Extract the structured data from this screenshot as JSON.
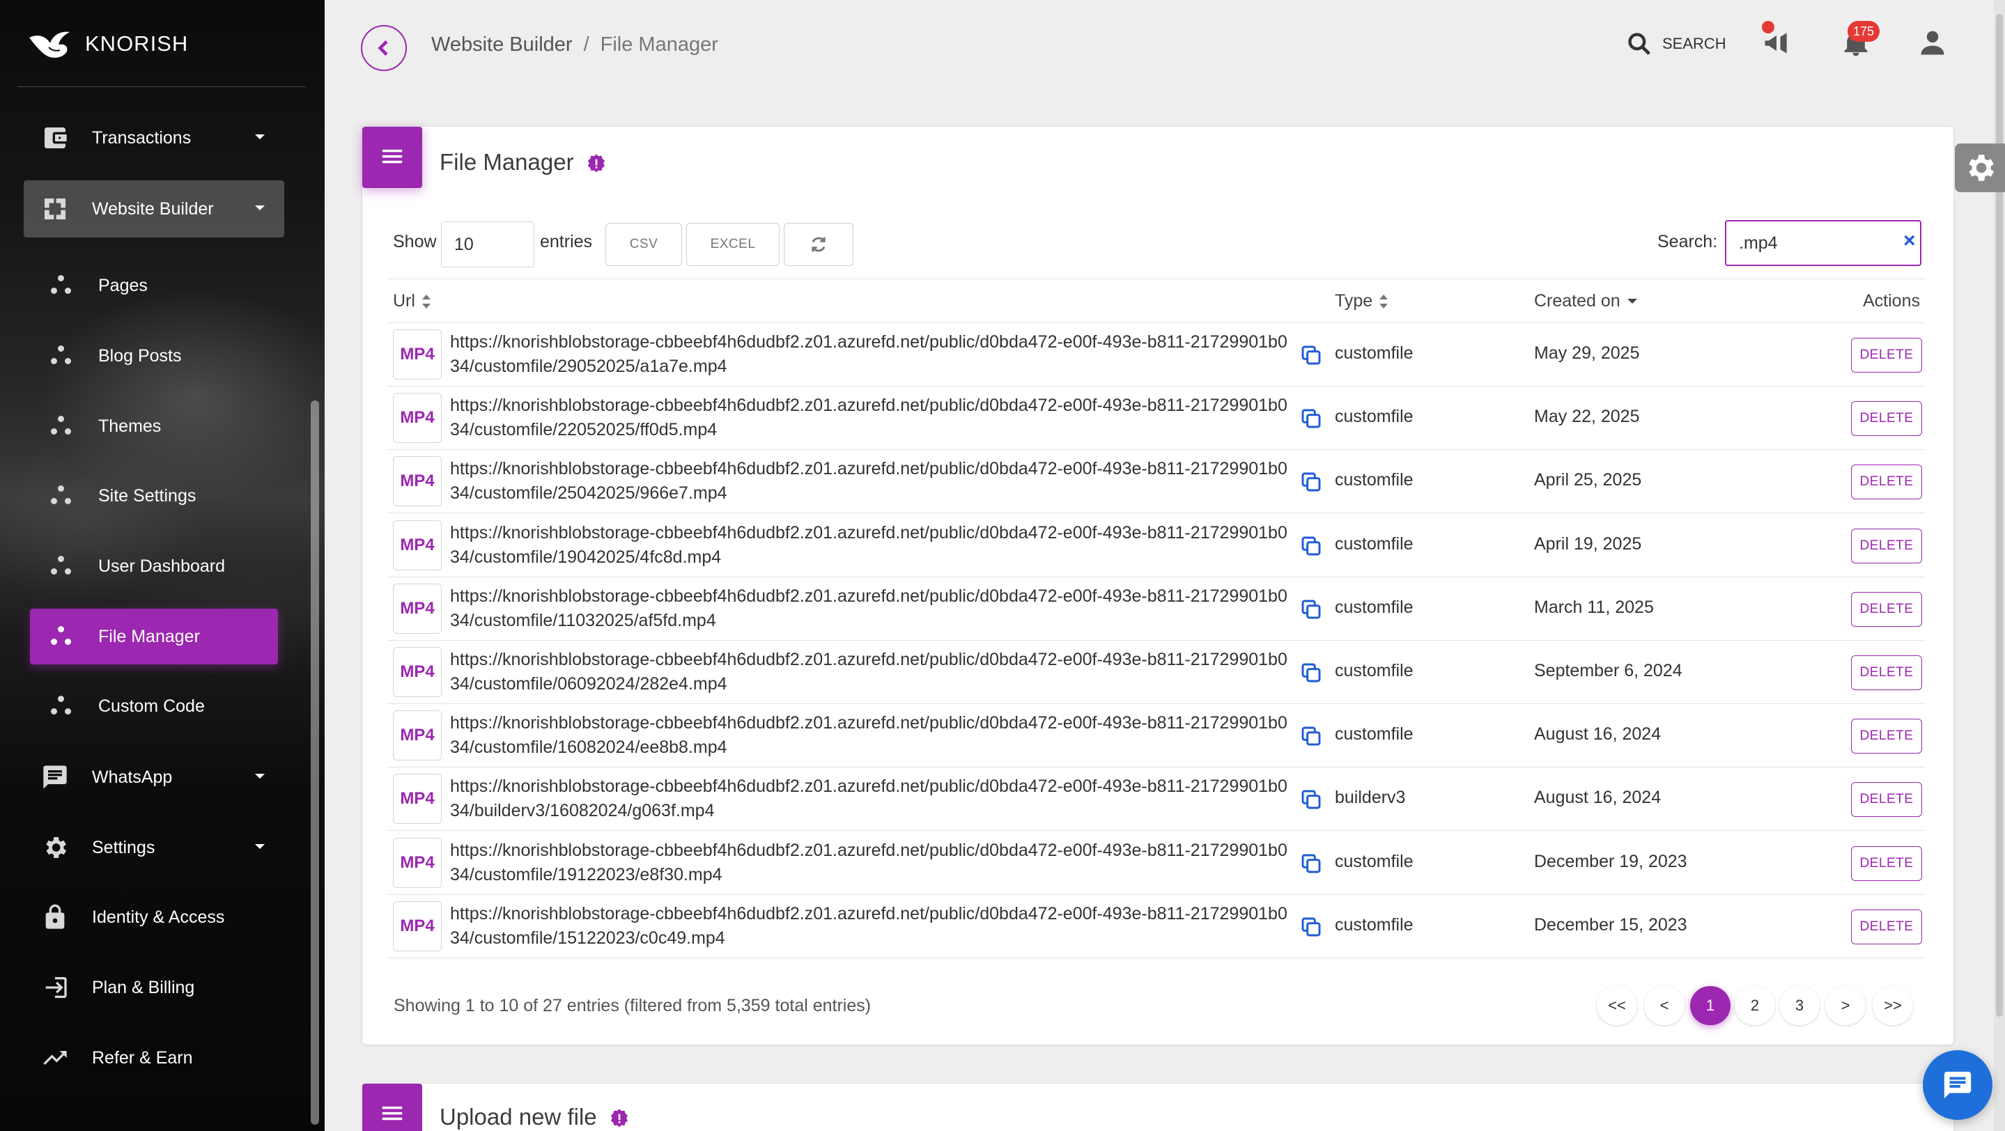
{
  "brand": {
    "name": "KNORISH"
  },
  "sidebar": {
    "items": [
      {
        "label": "Transactions",
        "icon": "wallet-icon",
        "expandable": true
      },
      {
        "label": "Website Builder",
        "icon": "builder-icon",
        "expandable": true,
        "active": true
      },
      {
        "label": "WhatsApp",
        "icon": "chat-box-icon",
        "expandable": true
      },
      {
        "label": "Settings",
        "icon": "gear-icon",
        "expandable": true
      },
      {
        "label": "Identity & Access",
        "icon": "lock-icon"
      },
      {
        "label": "Plan & Billing",
        "icon": "login-icon"
      },
      {
        "label": "Refer & Earn",
        "icon": "trending-up-icon"
      }
    ],
    "sub_items": [
      {
        "label": "Pages"
      },
      {
        "label": "Blog Posts"
      },
      {
        "label": "Themes"
      },
      {
        "label": "Site Settings"
      },
      {
        "label": "User Dashboard"
      },
      {
        "label": "File Manager",
        "active": true
      },
      {
        "label": "Custom Code"
      }
    ]
  },
  "header": {
    "breadcrumb": {
      "parent": "Website Builder",
      "separator": "/",
      "current": "File Manager"
    },
    "search_label": "SEARCH",
    "notifications_count": "175"
  },
  "file_manager": {
    "title": "File Manager",
    "show_label": "Show",
    "entries_value": "10",
    "entries_label": "entries",
    "buttons": {
      "csv": "CSV",
      "excel": "EXCEL"
    },
    "search_label": "Search:",
    "search_value": ".mp4",
    "search_clear": "×",
    "columns": {
      "url": "Url",
      "type": "Type",
      "created": "Created on",
      "actions": "Actions"
    },
    "file_badge": "MP4",
    "delete_label": "DELETE",
    "rows": [
      {
        "url1": "https://knorishblobstorage-cbbeebf4h6dudbf2.z01.azurefd.net/public/d0bda472-e00f-493e-b811-21729901b0",
        "url2": "34/customfile/29052025/a1a7e.mp4",
        "type": "customfile",
        "created": "May 29, 2025"
      },
      {
        "url1": "https://knorishblobstorage-cbbeebf4h6dudbf2.z01.azurefd.net/public/d0bda472-e00f-493e-b811-21729901b0",
        "url2": "34/customfile/22052025/ff0d5.mp4",
        "type": "customfile",
        "created": "May 22, 2025"
      },
      {
        "url1": "https://knorishblobstorage-cbbeebf4h6dudbf2.z01.azurefd.net/public/d0bda472-e00f-493e-b811-21729901b0",
        "url2": "34/customfile/25042025/966e7.mp4",
        "type": "customfile",
        "created": "April 25, 2025"
      },
      {
        "url1": "https://knorishblobstorage-cbbeebf4h6dudbf2.z01.azurefd.net/public/d0bda472-e00f-493e-b811-21729901b0",
        "url2": "34/customfile/19042025/4fc8d.mp4",
        "type": "customfile",
        "created": "April 19, 2025"
      },
      {
        "url1": "https://knorishblobstorage-cbbeebf4h6dudbf2.z01.azurefd.net/public/d0bda472-e00f-493e-b811-21729901b0",
        "url2": "34/customfile/11032025/af5fd.mp4",
        "type": "customfile",
        "created": "March 11, 2025"
      },
      {
        "url1": "https://knorishblobstorage-cbbeebf4h6dudbf2.z01.azurefd.net/public/d0bda472-e00f-493e-b811-21729901b0",
        "url2": "34/customfile/06092024/282e4.mp4",
        "type": "customfile",
        "created": "September 6, 2024"
      },
      {
        "url1": "https://knorishblobstorage-cbbeebf4h6dudbf2.z01.azurefd.net/public/d0bda472-e00f-493e-b811-21729901b0",
        "url2": "34/customfile/16082024/ee8b8.mp4",
        "type": "customfile",
        "created": "August 16, 2024"
      },
      {
        "url1": "https://knorishblobstorage-cbbeebf4h6dudbf2.z01.azurefd.net/public/d0bda472-e00f-493e-b811-21729901b0",
        "url2": "34/builderv3/16082024/g063f.mp4",
        "type": "builderv3",
        "created": "August 16, 2024"
      },
      {
        "url1": "https://knorishblobstorage-cbbeebf4h6dudbf2.z01.azurefd.net/public/d0bda472-e00f-493e-b811-21729901b0",
        "url2": "34/customfile/19122023/e8f30.mp4",
        "type": "customfile",
        "created": "December 19, 2023"
      },
      {
        "url1": "https://knorishblobstorage-cbbeebf4h6dudbf2.z01.azurefd.net/public/d0bda472-e00f-493e-b811-21729901b0",
        "url2": "34/customfile/15122023/c0c49.mp4",
        "type": "customfile",
        "created": "December 15, 2023"
      }
    ],
    "showing_text": "Showing 1 to 10 of 27 entries (filtered from 5,359 total entries)",
    "pagination": {
      "first": "<<",
      "prev": "<",
      "pages": [
        "1",
        "2",
        "3"
      ],
      "active_page": "1",
      "next": ">",
      "last": ">>"
    }
  },
  "upload": {
    "title": "Upload new file"
  },
  "colors": {
    "accent": "#9c27b0",
    "link_blue": "#1e5bd6",
    "badge_red": "#e53935",
    "chat_blue": "#1e6fd9"
  }
}
